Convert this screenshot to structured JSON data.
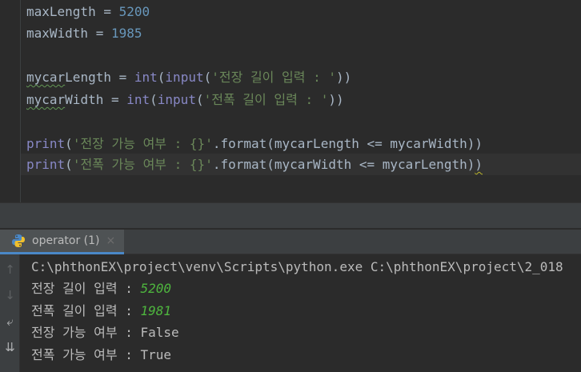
{
  "editor": {
    "lines": [
      {
        "var": "maxLength",
        "op": " = ",
        "num": "5200"
      },
      {
        "var": "maxWidth",
        "op": " = ",
        "num": "1985"
      },
      {
        "var": "mycar",
        "rest": "Length = ",
        "fn1": "int",
        "p1": "(",
        "fn2": "input",
        "p2": "(",
        "str": "'전장 길이 입력 : '",
        "close": "))"
      },
      {
        "var": "mycar",
        "rest": "Width = ",
        "fn1": "int",
        "p1": "(",
        "fn2": "input",
        "p2": "(",
        "str": "'전폭 길이 입력 : '",
        "close": "))"
      },
      {
        "fn": "print",
        "p": "(",
        "str": "'전장 가능 여부 : {}'",
        "rest": ".format(mycarLength <= mycarWidth))"
      },
      {
        "fn": "print",
        "p": "(",
        "str": "'전폭 가능 여부 : {}'",
        "rest": ".format(mycarWidth <= mycarLength)",
        "last": ")"
      }
    ]
  },
  "run_panel": {
    "tab_label": "operator (1)",
    "close_glyph": "×"
  },
  "console": {
    "command": "C:\\phthonEX\\project\\venv\\Scripts\\python.exe C:\\phthonEX\\project\\2_018",
    "prompt1": "전장 길이 입력 : ",
    "input1": "5200",
    "prompt2": "전폭 길이 입력 : ",
    "input2": "1981",
    "result1": "전장 가능 여부 : False",
    "result2": "전폭 가능 여부 : True"
  },
  "toolbar": {
    "icons": [
      "arrow-up-icon",
      "arrow-down-icon",
      "soft-wrap-icon",
      "scroll-to-end-icon"
    ],
    "glyphs": [
      "↑",
      "↓",
      "⤶",
      "⇊"
    ]
  },
  "colors": {
    "background": "#2b2b2b",
    "number": "#6897bb",
    "builtin": "#8888c6",
    "string": "#6a8759",
    "user_input": "#4eb53e"
  }
}
